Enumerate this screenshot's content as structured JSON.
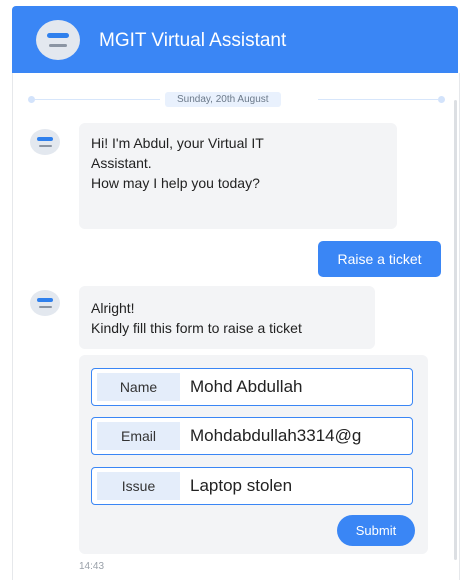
{
  "header": {
    "title": "MGIT Virtual Assistant"
  },
  "chat": {
    "date_label": "Sunday, 20th August",
    "bot_greeting": {
      "line1": "Hi! I'm Abdul, your Virtual IT",
      "line2": "Assistant.",
      "line3": "How may I help you today?"
    },
    "user_message": "Raise a ticket",
    "bot_reply": {
      "line1": "Alright!",
      "line2": "Kindly fill this form to raise a ticket"
    },
    "form": {
      "fields": [
        {
          "label": "Name",
          "value": "Mohd Abdullah"
        },
        {
          "label": "Email",
          "value": "Mohdabdullah3314@g"
        },
        {
          "label": "Issue",
          "value": "Laptop stolen"
        }
      ],
      "submit_label": "Submit"
    },
    "timestamp": "14:43"
  },
  "colors": {
    "accent": "#3a86f5",
    "bubble_bg": "#f3f4f6",
    "label_bg": "#e4edfa"
  },
  "icons": {
    "logo": "assistant-logo-icon",
    "avatar": "bot-avatar-icon"
  }
}
